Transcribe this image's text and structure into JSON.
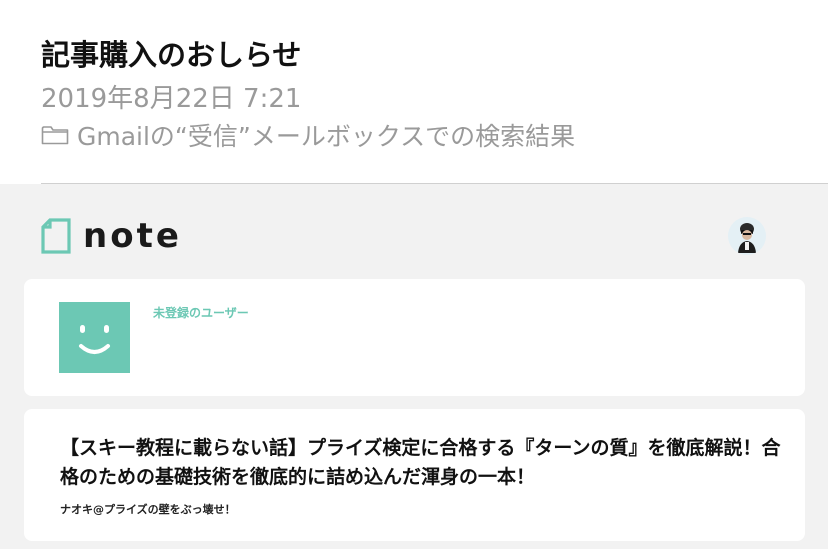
{
  "message": {
    "subject": "記事購入のおしらせ",
    "date": "2019年8月22日 7:21",
    "folder_icon": "folder-icon",
    "folder": "Gmailの“受信”メールボックスでの検索結果"
  },
  "email_body": {
    "logo_text": "note",
    "logo_icon": "note-logo-mark",
    "brand_color": "#6cc8b4",
    "avatar_icon": "user-avatar",
    "buyer": {
      "name": "未登録のユーザー",
      "avatar_icon": "smiley-face-icon"
    },
    "article": {
      "title": "【スキー教程に載らない話】プライズ検定に合格する『ターンの質』を徹底解説！合格のための基礎技術を徹底的に詰め込んだ渾身の一本！",
      "author": "ナオキ@プライズの壁をぶっ壊せ！"
    }
  }
}
